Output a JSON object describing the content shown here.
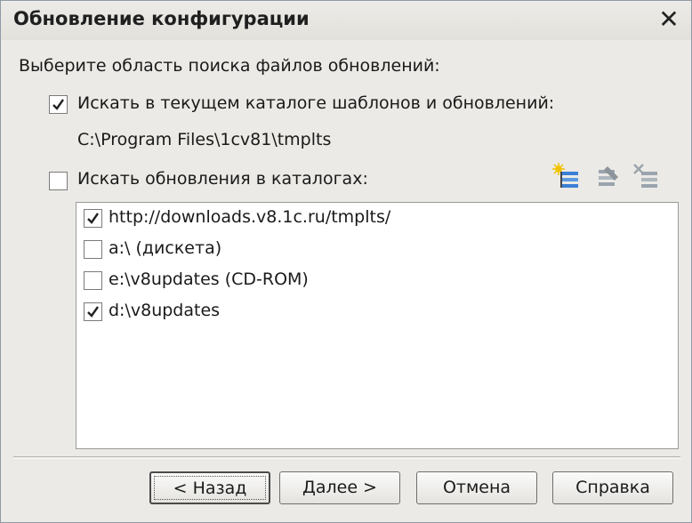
{
  "window": {
    "title": "Обновление конфигурации",
    "close_glyph": "✕"
  },
  "prompt": "Выберите область поиска файлов обновлений:",
  "option_current": {
    "checked": true,
    "label": "Искать в текущем каталоге шаблонов и обновлений:",
    "path": "C:\\Program Files\\1cv81\\tmplts"
  },
  "option_catalogs": {
    "checked": false,
    "label": "Искать обновления в каталогах:"
  },
  "toolbar": {
    "icons": [
      "add-catalog-icon",
      "edit-catalog-icon",
      "delete-catalog-icon"
    ]
  },
  "catalogs": [
    {
      "checked": true,
      "label": "http://downloads.v8.1c.ru/tmplts/"
    },
    {
      "checked": false,
      "label": "a:\\ (дискета)"
    },
    {
      "checked": false,
      "label": "e:\\v8updates (CD-ROM)"
    },
    {
      "checked": true,
      "label": "d:\\v8updates"
    }
  ],
  "buttons": {
    "back": "< Назад",
    "next": "Далее >",
    "cancel": "Отмена",
    "help": "Справка"
  }
}
